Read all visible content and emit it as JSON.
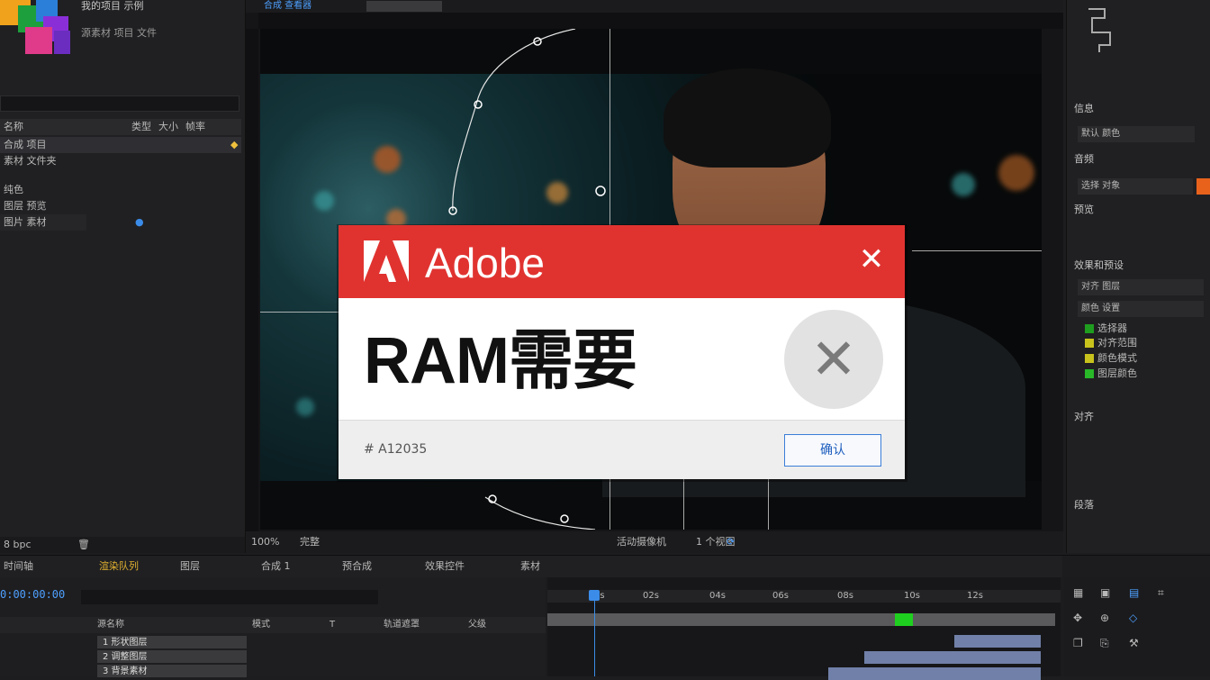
{
  "left_panel": {
    "title_line1": "我的项目 示例",
    "title_line2": "源素材 项目 文件",
    "columns": [
      "名称",
      "类型",
      "大小",
      "帧率"
    ],
    "items": [
      {
        "label": "合成 项目",
        "selected": true
      },
      {
        "label": "素材 文件夹",
        "selected": false
      },
      {
        "label": "纯色",
        "selected": false
      },
      {
        "label": "图层 预览",
        "selected": false
      },
      {
        "label": "图片 素材",
        "selected": false
      }
    ],
    "bottom_label": "8 bpc"
  },
  "viewer": {
    "tab_label": "合成 查看器",
    "toolbar_labels": [
      "100%",
      "完整",
      "活动摄像机",
      "1 个视图"
    ]
  },
  "right_panel": {
    "sections": [
      "信息",
      "音频",
      "预览",
      "效果和预设",
      "对齐",
      "段落"
    ],
    "fields": [
      "默认 颜色",
      "选择 对象",
      "对齐 图层",
      "颜色 设置"
    ],
    "swatches": [
      {
        "label": "选择器",
        "color": "#1f9d1f"
      },
      {
        "label": "对齐范围",
        "color": "#c8c21c"
      },
      {
        "label": "颜色模式",
        "color": "#c8c21c"
      },
      {
        "label": "图层颜色",
        "color": "#28b828"
      }
    ],
    "accent": "#e8621c"
  },
  "timeline": {
    "tabs": [
      "时间轴",
      "渲染队列",
      "图层",
      "合成 1",
      "预合成",
      "效果控件",
      "素材"
    ],
    "timecode": "0:00:00:00",
    "columns": [
      "源名称",
      "模式",
      "T",
      "轨道遮罩",
      "父级"
    ],
    "layers": [
      "1 形状图层",
      "2 调整图层",
      "3 背景素材"
    ],
    "ruler_ticks": [
      "0s",
      "02s",
      "04s",
      "06s",
      "08s",
      "10s",
      "12s"
    ],
    "bar_color": "#7080a8",
    "workarea_color": "#1fcf1f"
  },
  "dialog": {
    "brand": "Adobe",
    "message": "RAM需要",
    "error_code": "# A12035",
    "ok_label": "确认",
    "header_color": "#e03330",
    "close_icon": "close-icon",
    "error_icon": "error-x-icon"
  }
}
